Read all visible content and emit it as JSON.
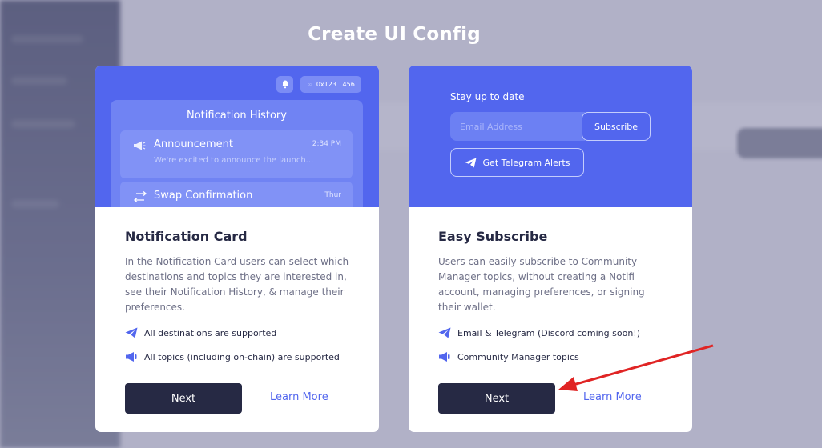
{
  "page": {
    "title": "Create UI Config"
  },
  "cards": [
    {
      "id": "notification-card",
      "preview": {
        "bell_icon": "bell-icon",
        "wallet_address": "0x123...456",
        "history_title": "Notification History",
        "items": [
          {
            "icon": "megaphone-icon",
            "title": "Announcement",
            "time": "2:34 PM",
            "preview": "We're excited to announce the launch..."
          },
          {
            "icon": "swap-arrows-icon",
            "title": "Swap Confirmation",
            "time": "Thur",
            "preview": ""
          }
        ]
      },
      "title": "Notification Card",
      "description": "In the Notification Card users can select which destinations and topics they are interested in, see their Notification History, & manage their preferences.",
      "features": [
        {
          "icon": "send-icon",
          "text": "All destinations are supported"
        },
        {
          "icon": "megaphone-icon",
          "text": "All topics (including on-chain) are supported"
        }
      ],
      "next_label": "Next",
      "learn_more_label": "Learn More"
    },
    {
      "id": "easy-subscribe",
      "preview": {
        "stay_label": "Stay up to date",
        "email_placeholder": "Email Address",
        "subscribe_label": "Subscribe",
        "telegram_label": "Get Telegram Alerts"
      },
      "title": "Easy Subscribe",
      "description": "Users can easily subscribe to Community Manager topics, without creating a Notifi account, managing preferences, or signing their wallet.",
      "features": [
        {
          "icon": "send-icon",
          "text": "Email & Telegram (Discord coming soon!)"
        },
        {
          "icon": "megaphone-icon",
          "text": "Community Manager topics"
        }
      ],
      "next_label": "Next",
      "learn_more_label": "Learn More"
    }
  ],
  "colors": {
    "accent": "#5266ee",
    "dark_button": "#262944",
    "annotation_arrow": "#e02424"
  }
}
